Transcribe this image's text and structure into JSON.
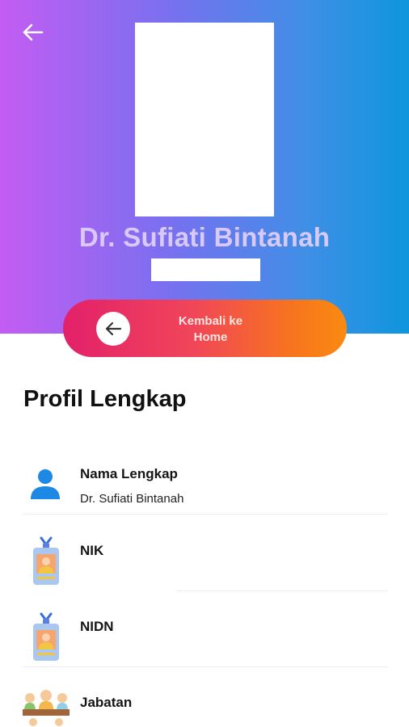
{
  "header": {
    "back_icon": "arrow-left-icon",
    "name": "Dr. Sufiati Bintanah"
  },
  "home_button": {
    "label": "Kembali ke Home",
    "icon": "arrow-left-icon"
  },
  "section": {
    "title": "Profil Lengkap"
  },
  "fields": [
    {
      "label": "Nama Lengkap",
      "value": "Dr. Sufiati Bintanah",
      "icon": "person-icon"
    },
    {
      "label": "NIK",
      "value": "",
      "icon": "id-card-icon"
    },
    {
      "label": "NIDN",
      "value": "",
      "icon": "id-card-icon"
    },
    {
      "label": "Jabatan",
      "value": "",
      "icon": "group-icon"
    }
  ],
  "colors": {
    "hero_gradient_start": "#c45cf2",
    "hero_gradient_end": "#0e96dd",
    "button_gradient_start": "#e3206a",
    "button_gradient_end": "#fb8a10",
    "person_icon": "#1e88e5"
  }
}
